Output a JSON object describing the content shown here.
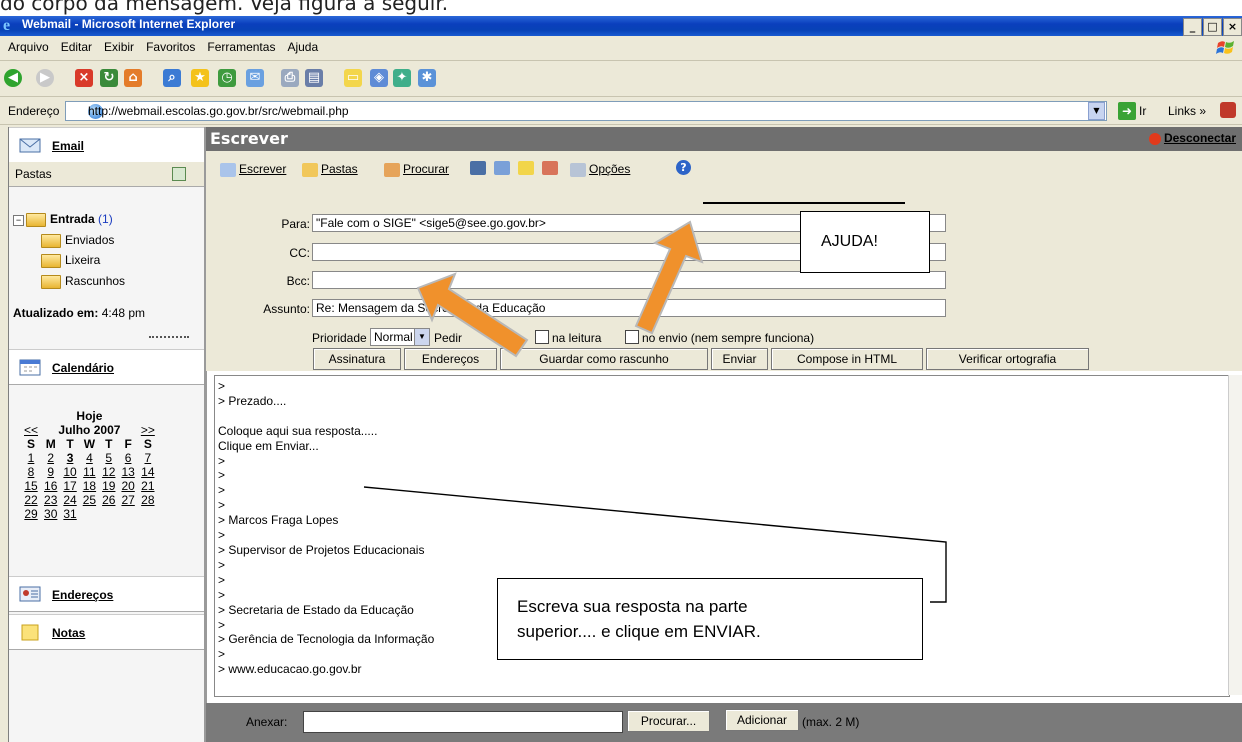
{
  "doc_caption": "do corpo da mensagem. Veja figura a seguir.",
  "window": {
    "title": "Webmail - Microsoft Internet Explorer",
    "buttons": [
      "_",
      "□",
      "×"
    ]
  },
  "menu": [
    "Arquivo",
    "Editar",
    "Exibir",
    "Favoritos",
    "Ferramentas",
    "Ajuda"
  ],
  "address_bar": {
    "label": "Endereço",
    "url": "http://webmail.escolas.go.gov.br/src/webmail.php",
    "go_label": "Ir",
    "links_label": "Links"
  },
  "sidebar": {
    "email_label": "Email",
    "folders_header": "Pastas",
    "folders": [
      {
        "name": "Entrada",
        "count": "(1)"
      },
      {
        "name": "Enviados"
      },
      {
        "name": "Lixeira"
      },
      {
        "name": "Rascunhos"
      }
    ],
    "updated_label": "Atualizado em:",
    "updated_time": "4:48 pm",
    "calendar_label": "Calendário",
    "calendar": {
      "today": "Hoje",
      "prev": "<<",
      "next": ">>",
      "month": "Julho 2007",
      "weekdays": [
        "S",
        "M",
        "T",
        "W",
        "T",
        "F",
        "S"
      ],
      "weeks": [
        [
          "1",
          "2",
          "3",
          "4",
          "5",
          "6",
          "7"
        ],
        [
          "8",
          "9",
          "10",
          "11",
          "12",
          "13",
          "14"
        ],
        [
          "15",
          "16",
          "17",
          "18",
          "19",
          "20",
          "21"
        ],
        [
          "22",
          "23",
          "24",
          "25",
          "26",
          "27",
          "28"
        ],
        [
          "29",
          "30",
          "31",
          "",
          "",
          "",
          ""
        ]
      ]
    },
    "addresses_label": "Endereços",
    "notes_label": "Notas"
  },
  "compose": {
    "header": "Escrever",
    "disconnect": "Desconectar",
    "toolbar": {
      "write": "Escrever",
      "folders": "Pastas",
      "search": "Procurar",
      "options": "Opções"
    },
    "fields": {
      "to_label": "Para:",
      "to_value": "\"Fale com o SIGE\" <sige5@see.go.gov.br>",
      "cc_label": "CC:",
      "cc_value": "",
      "bcc_label": "Bcc:",
      "bcc_value": "",
      "subject_label": "Assunto:",
      "subject_value": "Re: Mensagem da Secretaria da Educação"
    },
    "priority_label": "Prioridade",
    "priority_value": "Normal",
    "receipt_label": "Pedir",
    "read_label": "na leitura",
    "send_label": "no envio (nem sempre funciona)",
    "buttons": {
      "signature": "Assinatura",
      "addresses": "Endereços",
      "save_draft": "Guardar como rascunho",
      "send": "Enviar",
      "html": "Compose in HTML",
      "spell": "Verificar ortografia"
    },
    "body": ">\n> Prezado....\n\nColoque aqui sua resposta.....\nClique em Enviar...\n>\n>\n>\n>\n> Marcos Fraga Lopes\n>\n> Supervisor de Projetos Educacionais\n>\n>\n>\n> Secretaria de Estado da Educação\n>\n> Gerência de Tecnologia da Informação\n>\n> www.educacao.go.gov.br",
    "attach": {
      "label": "Anexar:",
      "browse": "Procurar...",
      "add": "Adicionar",
      "max": "(max. 2 M)"
    }
  },
  "annotations": {
    "help_box": "AJUDA!",
    "instruction_line1": "Escreva sua resposta na parte",
    "instruction_line2": "superior.... e clique em ENVIAR."
  },
  "colors": {
    "title_bar": "#0a3fbd",
    "compose_header": "#6f6f6f",
    "arrow": "#f0912c"
  }
}
